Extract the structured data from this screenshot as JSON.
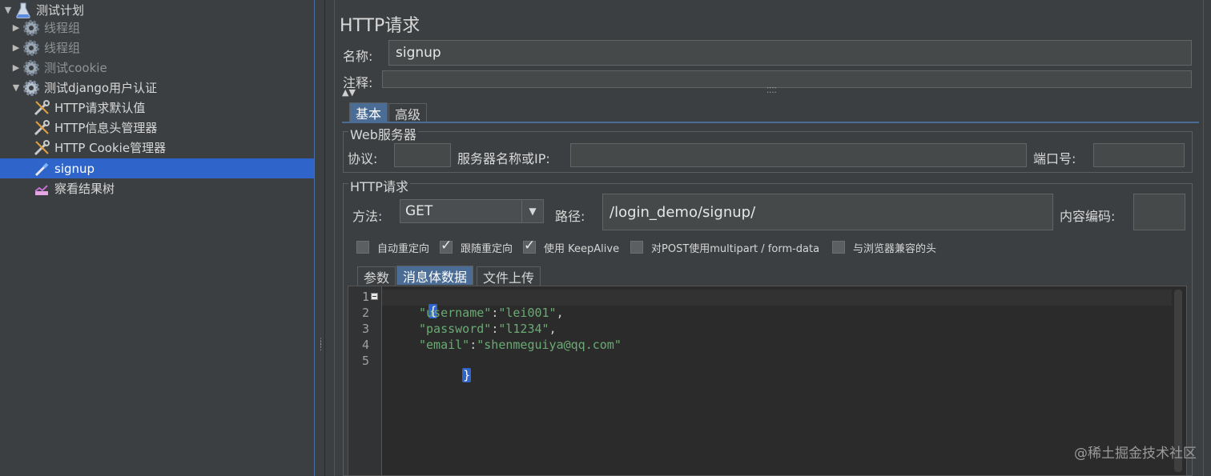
{
  "tree": {
    "items": [
      {
        "label": "测试计划"
      },
      {
        "label": "线程组"
      },
      {
        "label": "线程组"
      },
      {
        "label": "测试cookie"
      },
      {
        "label": "测试django用户认证"
      },
      {
        "label": "HTTP请求默认值"
      },
      {
        "label": "HTTP信息头管理器"
      },
      {
        "label": "HTTP Cookie管理器"
      },
      {
        "label": "signup"
      },
      {
        "label": "察看结果树"
      }
    ]
  },
  "panel": {
    "title": "HTTP请求",
    "name_label": "名称:",
    "name_value": "signup",
    "comment_label": "注释:",
    "comment_value": "",
    "tabs": [
      {
        "label": "基本"
      },
      {
        "label": "高级"
      }
    ],
    "web_server": {
      "legend": "Web服务器",
      "protocol_label": "协议:",
      "protocol_value": "",
      "server_label": "服务器名称或IP:",
      "server_value": "",
      "port_label": "端口号:",
      "port_value": ""
    },
    "http_request": {
      "legend": "HTTP请求",
      "method_label": "方法:",
      "method_value": "GET",
      "path_label": "路径:",
      "path_value": "/login_demo/signup/",
      "encoding_label": "内容编码:",
      "encoding_value": "",
      "checkboxes": [
        {
          "label": "自动重定向",
          "checked": false
        },
        {
          "label": "跟随重定向",
          "checked": true
        },
        {
          "label": "使用 KeepAlive",
          "checked": true
        },
        {
          "label": "对POST使用multipart / form-data",
          "checked": false
        },
        {
          "label": "与浏览器兼容的头",
          "checked": false
        }
      ]
    },
    "body_tabs": [
      {
        "label": "参数"
      },
      {
        "label": "消息体数据"
      },
      {
        "label": "文件上传"
      }
    ],
    "editor": {
      "line_numbers": [
        "1",
        "2",
        "3",
        "4",
        "5"
      ],
      "lines": {
        "open_brace": "{",
        "username_key": "\"username\"",
        "username_val": "\"lei001\"",
        "password_key": "\"password\"",
        "password_val": "\"l1234\"",
        "email_key": "\"email\"",
        "email_val": "\"shenmeguiya@qq.com\"",
        "close_brace": "}",
        "colon": ":",
        "comma": ","
      }
    }
  },
  "watermark": "@稀土掘金技术社区",
  "colors": {
    "selection": "#2f65ca",
    "string": "#6aab73",
    "background": "#3c3f41"
  }
}
